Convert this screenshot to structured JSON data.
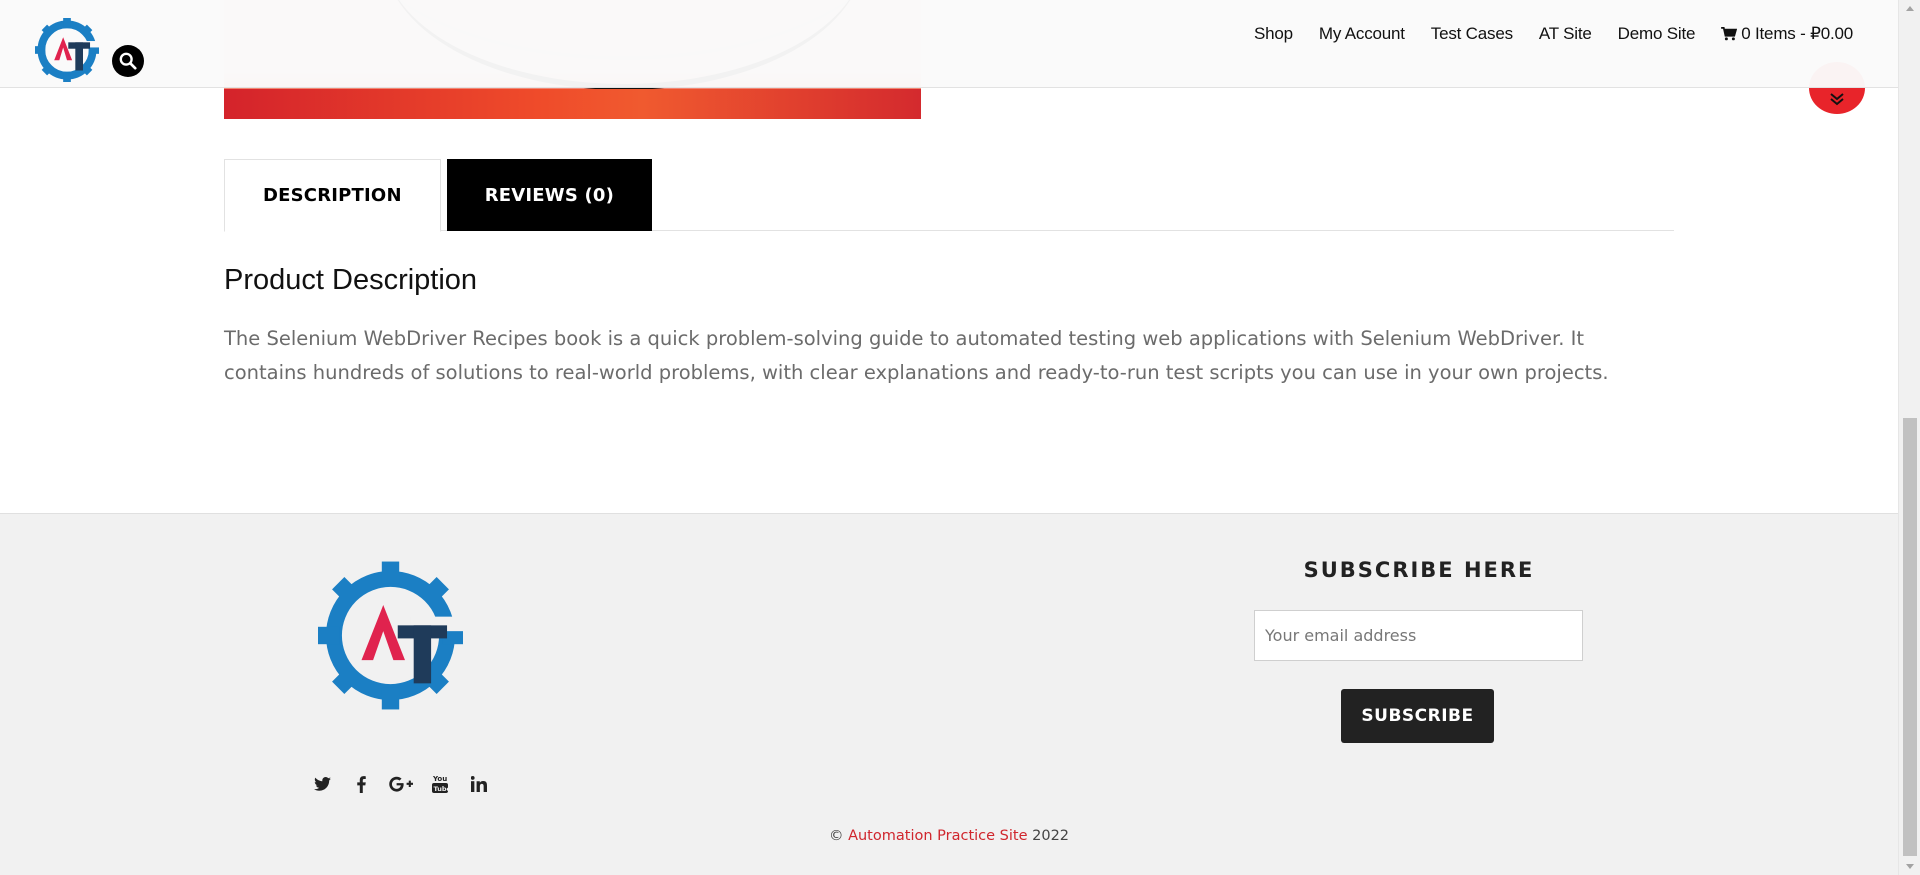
{
  "header": {
    "nav": [
      {
        "label": "Shop"
      },
      {
        "label": "My Account"
      },
      {
        "label": "Test Cases"
      },
      {
        "label": "AT Site"
      },
      {
        "label": "Demo Site"
      }
    ],
    "cart_label": "0 Items - ₽0.00"
  },
  "tabs": [
    {
      "label": "DESCRIPTION",
      "active": true
    },
    {
      "label": "REVIEWS (0)",
      "active": false
    }
  ],
  "description": {
    "title": "Product Description",
    "text": "The Selenium WebDriver Recipes book is a quick problem-solving guide to automated testing web applications with Selenium WebDriver. It contains hundreds of solutions to real-world problems, with clear explanations and ready-to-run test scripts you can use in your own projects."
  },
  "footer": {
    "subscribe_title": "SUBSCRIBE HERE",
    "email_placeholder": "Your email address",
    "subscribe_label": "SUBSCRIBE",
    "copyright_symbol": "©",
    "copyright_site": "Automation Practice Site",
    "copyright_year": "2022",
    "social_icons": [
      "twitter-icon",
      "facebook-icon",
      "google-plus-icon",
      "youtube-icon",
      "linkedin-icon"
    ]
  },
  "colors": {
    "accent_red": "#e8242a",
    "logo_blue": "#1b7fc4",
    "logo_navy": "#1f3b5a",
    "logo_pink": "#e0234e",
    "tab_dark": "#000000",
    "footer_bg": "#f1f1f1"
  }
}
